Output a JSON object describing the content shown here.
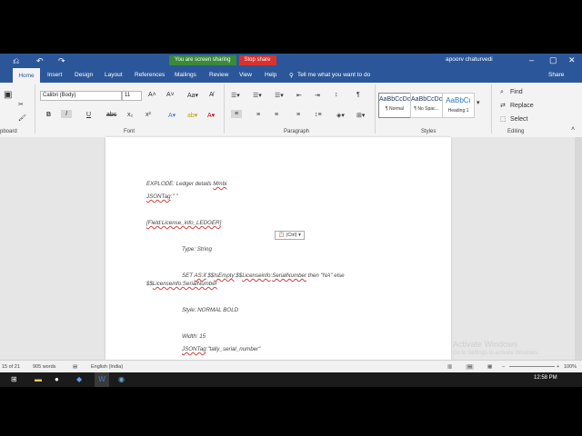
{
  "screen_share": {
    "notice": "You are screen sharing",
    "stop": "Stop share"
  },
  "user": {
    "name": "apoorv chaturvedi"
  },
  "tabs": [
    "Home",
    "Insert",
    "Design",
    "Layout",
    "References",
    "Mailings",
    "Review",
    "View",
    "Help"
  ],
  "tell_me": "Tell me what you want to do",
  "share": "Share",
  "font": {
    "name": "Calibri (Body)",
    "size": "11"
  },
  "groups": {
    "clipboard": "pboard",
    "font": "Font",
    "paragraph": "Paragraph",
    "styles": "Styles",
    "editing": "Editing"
  },
  "styles": [
    {
      "preview": "AaBbCcDc",
      "name": "¶ Normal"
    },
    {
      "preview": "AaBbCcDc",
      "name": "¶ No Spac..."
    },
    {
      "preview": "AaBbCı",
      "name": "Heading 1"
    }
  ],
  "editing": {
    "find": "Find",
    "replace": "Replace",
    "select": "Select"
  },
  "document_lines": {
    "l1": "EXPLODE: Ledger details ",
    "l1b": "Mmbi",
    "l2": "JSONTag",
    "l2b": ":\" \"",
    "l3": "[Field:License_info_LEDGER]",
    "l4": "Type: String",
    "l5a": "SET ",
    "l5b": "AS:if",
    "l5c": " $$",
    "l5d": "IsEmpty",
    "l5e": ":$$",
    "l5f": "Licenseinfo",
    "l5g": ":",
    "l5h": "SerialNumber",
    "l5i": " then \"NA\" else",
    "l6a": "$$",
    "l6b": "Licenseinfo:SerialNumber",
    "l7": "Style: NORMAL BOLD",
    "l8": "Width: 15",
    "l9a": "JSONTag",
    "l9b": ":\"tally_serial_number\""
  },
  "paste_options": "(Ctrl)",
  "watermark": {
    "title": "Activate Windows",
    "sub": "Go to Settings to activate Windows."
  },
  "status": {
    "page": "15 of 21",
    "words": "905 words",
    "language": "English (India)",
    "zoom": "100%"
  },
  "clock": "12:58 PM"
}
